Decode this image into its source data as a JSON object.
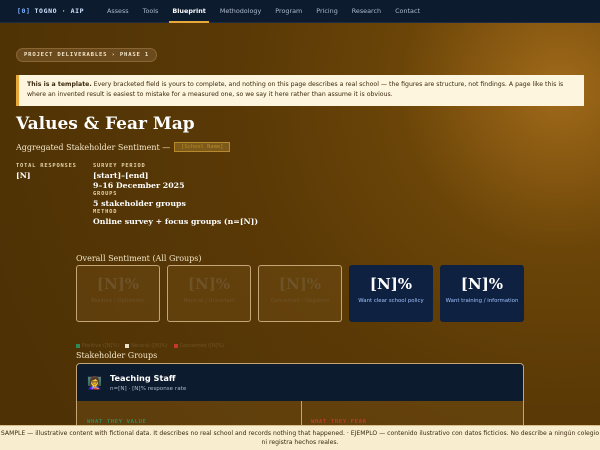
{
  "nav": {
    "brand_mark": "[0]",
    "brand_name": "TOGNO · AIP",
    "items": [
      {
        "label": "Assess"
      },
      {
        "label": "Tools"
      },
      {
        "label": "Blueprint",
        "active": true
      },
      {
        "label": "Methodology"
      },
      {
        "label": "Program"
      },
      {
        "label": "Pricing"
      },
      {
        "label": "Research"
      },
      {
        "label": "Contact"
      }
    ]
  },
  "breadcrumb_pill": "PROJECT DELIVERABLES  › PHASE 1",
  "notice": {
    "lead": "This is a template.",
    "body": "Every bracketed field is yours to complete, and nothing on this page describes a real school — the figures are structure, not findings. A page like this is where an invented result is easiest to mistake for a measured one, so we say it here rather than assume it is obvious."
  },
  "page": {
    "title": "Values & Fear Map",
    "subtitle": "Aggregated Stakeholder Sentiment —",
    "subtitle_badge": "[School Name]"
  },
  "meta": {
    "total_responses": {
      "label": "TOTAL RESPONSES",
      "value": "[N]"
    },
    "survey_period": {
      "label": "SURVEY PERIOD",
      "value": "[start]–[end]",
      "value2": "9–16 December 2025"
    },
    "groups": {
      "label": "GROUPS",
      "value": "5 stakeholder groups"
    },
    "method": {
      "label": "METHOD",
      "value": "Online survey + focus groups (n=[N])"
    }
  },
  "sentiment": {
    "heading": "Overall Sentiment (All Groups)",
    "cards": [
      {
        "value": "[N]%",
        "label": "Positive / Optimistic",
        "dark": false
      },
      {
        "value": "[N]%",
        "label": "Neutral / Uncertain",
        "dark": false
      },
      {
        "value": "[N]%",
        "label": "Concerned / Negative",
        "dark": false
      },
      {
        "value": "[N]%",
        "label": "Want clear school policy",
        "dark": true
      },
      {
        "value": "[N]%",
        "label": "Want training / information",
        "dark": true
      }
    ],
    "legend": [
      {
        "label": "Positive ([N]%)",
        "color": "#2e8b57"
      },
      {
        "label": "Neutral ([N]%)",
        "color": "#e8e0cc"
      },
      {
        "label": "Concerned ([N]%)",
        "color": "#c0392b"
      }
    ]
  },
  "stakeholders": {
    "heading": "Stakeholder Groups",
    "group": {
      "icon": "teacher-icon",
      "name": "Teaching Staff",
      "meta": "n=[N] · [N]% response rate",
      "col_left": "WHAT THEY VALUE",
      "col_right": "WHAT THEY FEAR",
      "col_left_color": "#2e8b57",
      "col_right_color": "#c0392b"
    }
  },
  "sample_banner": "SAMPLE — illustrative content with fictional data. It describes no real school and records nothing that happened. · EJEMPLO — contenido ilustrativo con datos ficticios. No describe a ningún colegio ni registra hechos reales."
}
